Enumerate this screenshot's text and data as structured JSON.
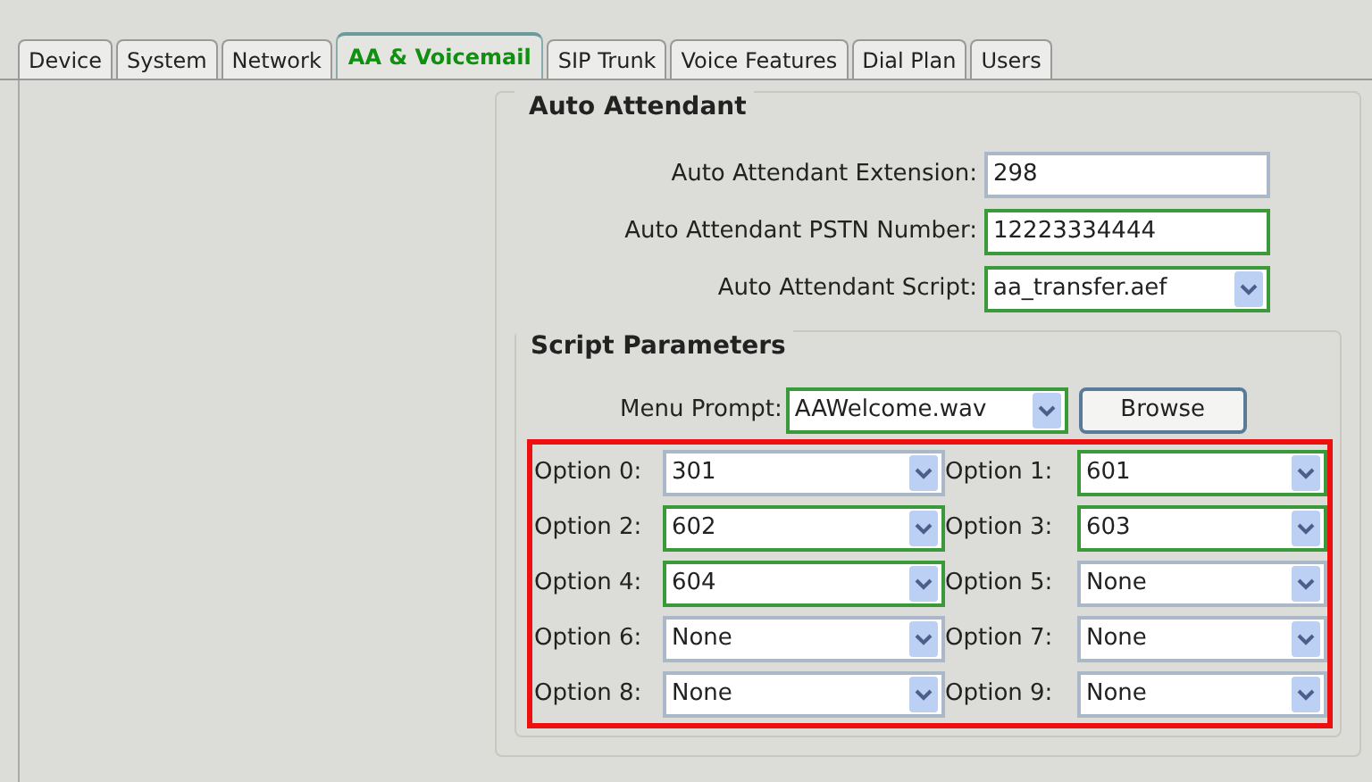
{
  "tabs": [
    {
      "label": "Device",
      "selected": false
    },
    {
      "label": "System",
      "selected": false
    },
    {
      "label": "Network",
      "selected": false
    },
    {
      "label": "AA & Voicemail",
      "selected": true
    },
    {
      "label": "SIP Trunk",
      "selected": false
    },
    {
      "label": "Voice Features",
      "selected": false
    },
    {
      "label": "Dial Plan",
      "selected": false
    },
    {
      "label": "Users",
      "selected": false
    }
  ],
  "auto_attendant": {
    "title": "Auto Attendant",
    "fields": [
      {
        "kind": "text",
        "label": "Auto Attendant Extension:",
        "value": "298",
        "highlighted": false
      },
      {
        "kind": "text",
        "label": "Auto Attendant PSTN Number:",
        "value": "12223334444",
        "highlighted": true
      },
      {
        "kind": "select",
        "label": "Auto Attendant Script:",
        "value": "aa_transfer.aef",
        "highlighted": true
      }
    ]
  },
  "script_parameters": {
    "title": "Script Parameters",
    "menu_prompt": {
      "label": "Menu Prompt:",
      "value": "AAWelcome.wav",
      "highlighted": true
    },
    "browse_button": "Browse",
    "options_highlighted": true,
    "options": [
      {
        "label": "Option 0:",
        "value": "301",
        "highlighted": false
      },
      {
        "label": "Option 1:",
        "value": "601",
        "highlighted": true
      },
      {
        "label": "Option 2:",
        "value": "602",
        "highlighted": true
      },
      {
        "label": "Option 3:",
        "value": "603",
        "highlighted": true
      },
      {
        "label": "Option 4:",
        "value": "604",
        "highlighted": true
      },
      {
        "label": "Option 5:",
        "value": "None",
        "highlighted": false
      },
      {
        "label": "Option 6:",
        "value": "None",
        "highlighted": false
      },
      {
        "label": "Option 7:",
        "value": "None",
        "highlighted": false
      },
      {
        "label": "Option 8:",
        "value": "None",
        "highlighted": false
      },
      {
        "label": "Option 9:",
        "value": "None",
        "highlighted": false
      }
    ]
  }
}
